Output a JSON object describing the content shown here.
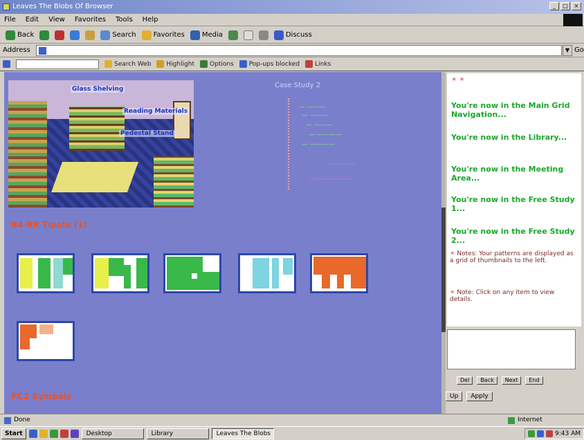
{
  "window": {
    "title": "Leaves The Blobs Of Browser"
  },
  "menu": [
    "File",
    "Edit",
    "View",
    "Favorites",
    "Tools",
    "Help"
  ],
  "toolbar": [
    "Back",
    "Forward",
    "Stop",
    "Refresh",
    "Home",
    "Search",
    "Favorites",
    "Media",
    "History",
    "Mail",
    "Print",
    "Edit",
    "Discuss"
  ],
  "address": {
    "label": "Address",
    "value": "",
    "go": "Go"
  },
  "linksbar": {
    "items": [
      "Search Web",
      "Highlight",
      "Options",
      "Pop-ups blocked",
      "Links"
    ]
  },
  "content": {
    "scene_labels": {
      "l1": "Glass Shelving",
      "l2": "Reading Materials",
      "l3": "Pedestal Stand"
    },
    "case_title": "Case Study 2",
    "legend": [
      "— ———",
      "— ———",
      "— ———",
      "— ————",
      "— ————",
      "— ———",
      "— ——————"
    ],
    "section1": "B4-BR Tipolo (1)",
    "section2": "PC2 Symbols"
  },
  "sidebar": {
    "links": [
      "You're now in the Main Grid Navigation...",
      "You're now in the Library...",
      "You're now in the Meeting Area...",
      "You're now in the Free Study 1...",
      "You're now in the Free Study 2..."
    ],
    "notes": [
      "Notes: Your patterns are displayed as a grid of thumbnails to the left.",
      "Note: Click on any item to view details."
    ],
    "ta_buttons": [
      "Del",
      "Back",
      "Next",
      "End"
    ],
    "bottom_buttons": [
      "Up",
      "Apply"
    ]
  },
  "status": {
    "left": "Done",
    "zone": "Internet"
  },
  "taskbar": {
    "start": "Start",
    "tasks": [
      "Desktop",
      "Library",
      "Leaves The Blobs"
    ],
    "clock": "9:43 AM"
  },
  "colors": {
    "content_bg": "#7a7fcc",
    "section_title": "#e8532a",
    "sidebar_link": "#1aa82a"
  }
}
